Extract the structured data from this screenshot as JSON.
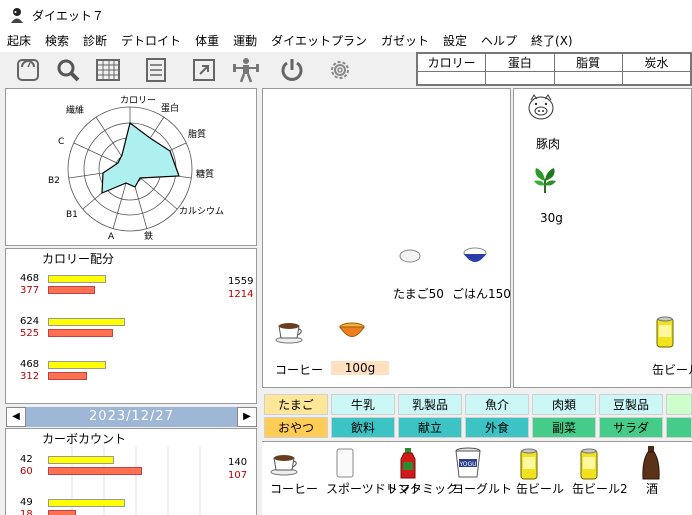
{
  "window": {
    "title": "ダイエット７"
  },
  "menu": [
    "起床",
    "検索",
    "診断",
    "デトロイト",
    "体重",
    "運動",
    "ダイエットプラン",
    "ガゼット",
    "設定",
    "ヘルプ",
    "終了(X)"
  ],
  "toolbar": {
    "icons": [
      "scale-icon",
      "search-icon",
      "grid-icon",
      "list-icon",
      "export-icon",
      "exercise-icon",
      "power-icon",
      "gear-icon"
    ]
  },
  "nutrition_header": {
    "columns": [
      "カロリー",
      "蛋白",
      "脂質",
      "炭水"
    ]
  },
  "radar": {
    "labels": [
      "カロリー",
      "蛋白",
      "脂質",
      "糖質",
      "カルシウム",
      "鉄",
      "A",
      "B1",
      "B2",
      "C",
      "繊維"
    ]
  },
  "calorie_panel": {
    "title": "カロリー配分",
    "rows": [
      {
        "target": "468",
        "actual": "377"
      },
      {
        "target": "624",
        "actual": "525"
      },
      {
        "target": "468",
        "actual": "312"
      }
    ],
    "total_target": "1559",
    "total_actual": "1214"
  },
  "date": {
    "value": "2023/12/27",
    "prev": "◀",
    "next": "▶"
  },
  "carb_panel": {
    "title": "カーボカウント",
    "rows": [
      {
        "target": "42",
        "actual": "60"
      },
      {
        "target": "49",
        "actual": "18"
      }
    ],
    "total_target": "140",
    "total_actual": "107"
  },
  "plate_middle": {
    "items": [
      {
        "name": "たまご50",
        "icon": "egg-icon"
      },
      {
        "name": "ごはん150",
        "icon": "rice-bowl-icon"
      },
      {
        "name": "コーヒー",
        "icon": "coffee-cup-icon"
      },
      {
        "name": "100g",
        "icon": "soup-bowl-icon"
      }
    ]
  },
  "plate_right": {
    "items": [
      {
        "name": "豚肉",
        "icon": "pig-icon"
      },
      {
        "name": "30g",
        "icon": "spinach-icon"
      },
      {
        "name": "缶ビール",
        "icon": "beer-can-icon"
      }
    ]
  },
  "categories": {
    "top": [
      "たまご",
      "牛乳",
      "乳製品",
      "魚介",
      "肉類",
      "豆製品"
    ],
    "bottom": [
      "おやつ",
      "飲料",
      "献立",
      "外食",
      "副菜",
      "サラダ"
    ]
  },
  "food_list": [
    "コーヒー",
    "スポーツドリンク",
    "トマトミック",
    "ヨーグルト",
    "缶ビール",
    "缶ビール2",
    "酒"
  ],
  "colors": {
    "radar_fill": "#aef0f0",
    "bar_target": "#ffff00",
    "bar_actual": "#ff7050",
    "date_bg": "#9fb7d6"
  }
}
